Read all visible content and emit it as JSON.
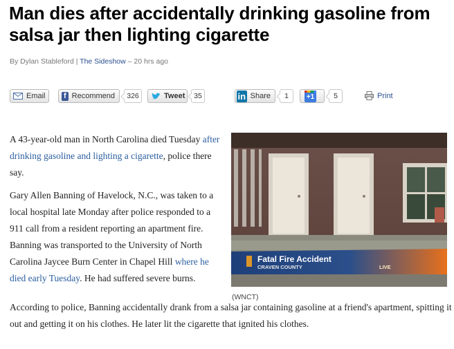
{
  "article": {
    "headline": "Man dies after accidentally drinking gasoline from salsa jar then lighting cigarette",
    "byline_author": "By Dylan Stableford | ",
    "byline_source": "The Sideshow",
    "byline_time": " – 20 hrs ago",
    "p1_before": "A 43-year-old man in North Carolina died Tuesday ",
    "p1_link": "after drinking gasoline and lighting a cigarette",
    "p1_after": ", police there say.",
    "p2_before": "Gary Allen Banning of Havelock, N.C., was taken to a local hospital late Monday after police responded to a 911 call from a resident reporting an apartment fire. Banning was transported to the University of North Carolina Jaycee Burn Center in Chapel Hill ",
    "p2_link": "where he died early Tuesday",
    "p2_after": ". He had suffered severe burns.",
    "p3": "According to police, Banning accidentally drank from a salsa jar containing gasoline at a friend's apartment, spitting it out and getting it on his clothes. He later lit the cigarette that ignited his clothes."
  },
  "share": {
    "email_label": "Email",
    "recommend_label": "Recommend",
    "recommend_count": "326",
    "tweet_label": "Tweet",
    "tweet_count": "35",
    "share_label": "Share",
    "share_count": "1",
    "plusone_label": "+1",
    "plusone_count": "5",
    "print_label": "Print",
    "icons": [
      "envelope-icon",
      "facebook-icon",
      "twitter-bird-icon",
      "linkedin-icon",
      "google-plus-one-icon",
      "printer-icon"
    ]
  },
  "figure": {
    "chyron_title": "Fatal Fire Accident",
    "chyron_subtitle": "CRAVEN COUNTY",
    "chyron_live": "LIVE",
    "caption": "(WNCT)",
    "chyron_color": "#e8701c"
  },
  "colors": {
    "link": "#2a5d9f",
    "byline_link": "#2a4f8f",
    "facebook": "#3b5998",
    "linkedin": "#0e76a8",
    "twitter": "#2aa9e0"
  }
}
